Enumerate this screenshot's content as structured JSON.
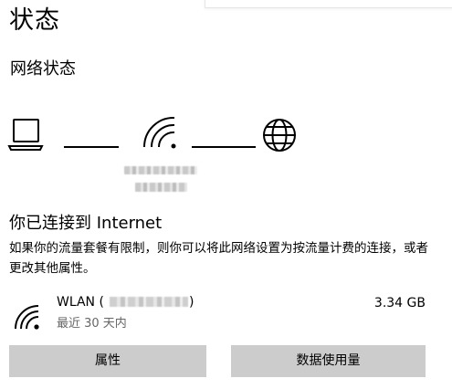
{
  "page": {
    "title": "状态",
    "section_title": "网络状态"
  },
  "connection": {
    "heading": "你已连接到 Internet",
    "description": "如果你的流量套餐有限制，则你可以将此网络设置为按流量计费的连接，或者更改其他属性。"
  },
  "network": {
    "adapter_prefix": "WLAN (",
    "adapter_suffix": ")",
    "period": "最近 30 天内",
    "usage": "3.34 GB"
  },
  "buttons": {
    "properties": "属性",
    "data_usage": "数据使用量"
  },
  "icons": {
    "computer": "laptop-icon",
    "wifi": "wifi-icon",
    "internet": "globe-icon",
    "adapter": "wifi-signal-icon"
  }
}
